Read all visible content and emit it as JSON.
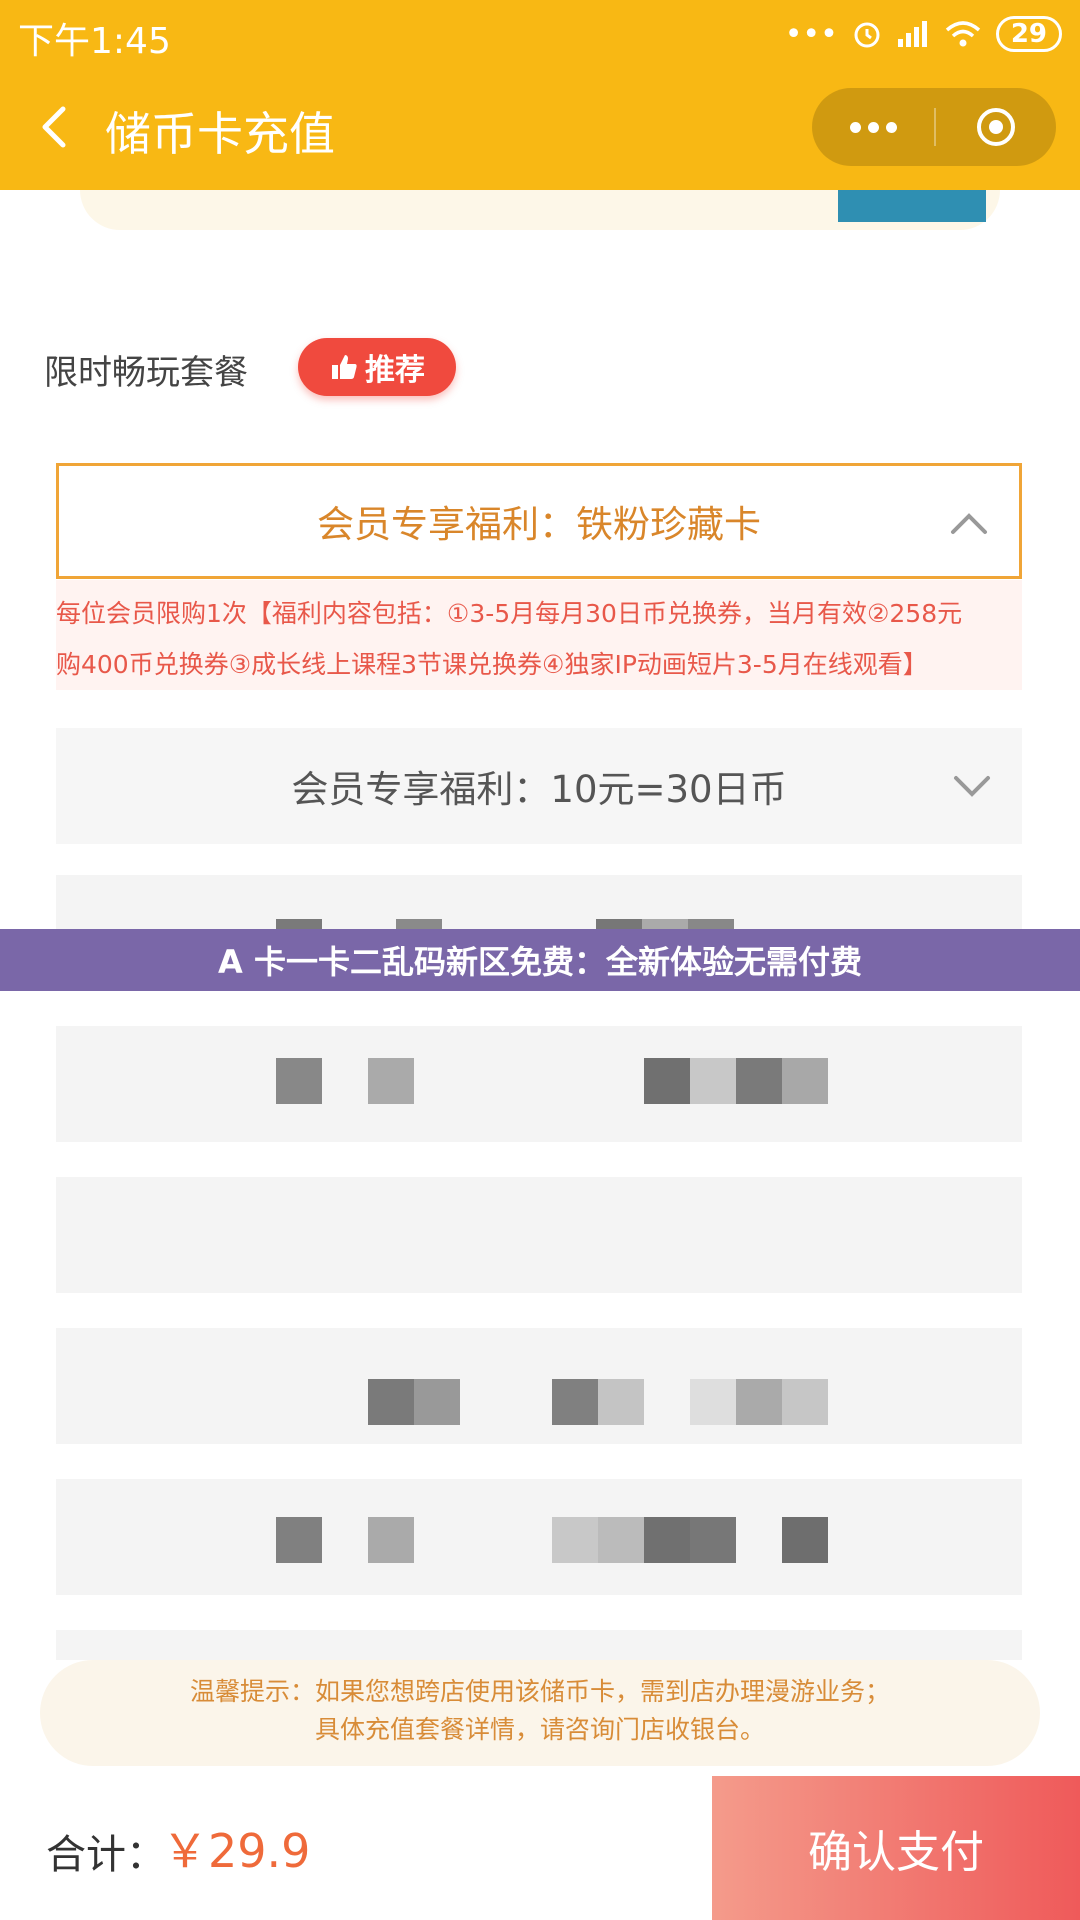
{
  "status_bar": {
    "time": "下午1:45",
    "dots": "•••",
    "battery": "29"
  },
  "nav": {
    "title": "储币卡充值"
  },
  "section": {
    "title": "限时畅玩套餐",
    "badge": "推荐"
  },
  "options": [
    {
      "label": "会员专享福利：铁粉珍藏卡",
      "expanded": true
    },
    {
      "label": "会员专享福利：10元=30日币",
      "expanded": false
    }
  ],
  "benefit": {
    "line1": "每位会员限购1次【福利内容包括：①3-5月每月30日币兑换券，当月有效②258元",
    "line2": "购400币兑换券③成长线上课程3节课兑换券④独家IP动画短片3-5月在线观看】"
  },
  "banner": "A 卡一卡二乱码新区免费：全新体验无需付费",
  "tip": {
    "line1": "温馨提示：如果您想跨店使用该储币卡，需到店办理漫游业务；",
    "line2": "具体充值套餐详情，请咨询门店收银台。"
  },
  "footer": {
    "total_label": "合计：",
    "total_value": "￥29.9",
    "pay_label": "确认支付"
  },
  "colors": {
    "header": "#f8b814",
    "banner": "#7a67a8",
    "pay": "#ef5a5a",
    "accent": "#d9862a"
  }
}
